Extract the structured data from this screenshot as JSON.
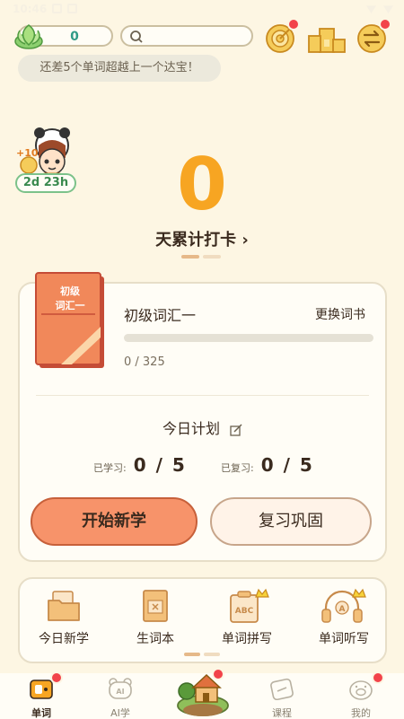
{
  "status_bar": {
    "time": "10:46"
  },
  "top": {
    "gem_count": "0",
    "search_placeholder": ""
  },
  "hint": "还差5个单词超越上一个达宝！",
  "avatar": {
    "bonus": "+10",
    "timer": "2d 23h"
  },
  "checkin": {
    "count": "0",
    "label": "天累计打卡 ›"
  },
  "book": {
    "cover_line1": "初级",
    "cover_line2": "词汇一",
    "name": "初级词汇一",
    "change_label": "更换词书",
    "progress_text": "0 / 325",
    "progress_fraction": 0
  },
  "plan": {
    "title": "今日计划",
    "learned_label": "已学习:",
    "learned_value": "0 / 5",
    "reviewed_label": "已复习:",
    "reviewed_value": "0 / 5"
  },
  "buttons": {
    "start": "开始新学",
    "review": "复习巩固"
  },
  "features": [
    {
      "label": "今日新学",
      "icon": "folder-icon"
    },
    {
      "label": "生词本",
      "icon": "notebook-icon"
    },
    {
      "label": "单词拼写",
      "icon": "abc-board-icon"
    },
    {
      "label": "单词听写",
      "icon": "headphones-icon"
    }
  ],
  "nav": {
    "words": "单词",
    "ai": "AI学",
    "courses": "课程",
    "mine": "我的",
    "ai_badge": "AI"
  },
  "colors": {
    "background": "#FDF6E3",
    "accent_orange": "#F7A522",
    "start_button": "#F7936A",
    "badge_red": "#F2434A"
  }
}
